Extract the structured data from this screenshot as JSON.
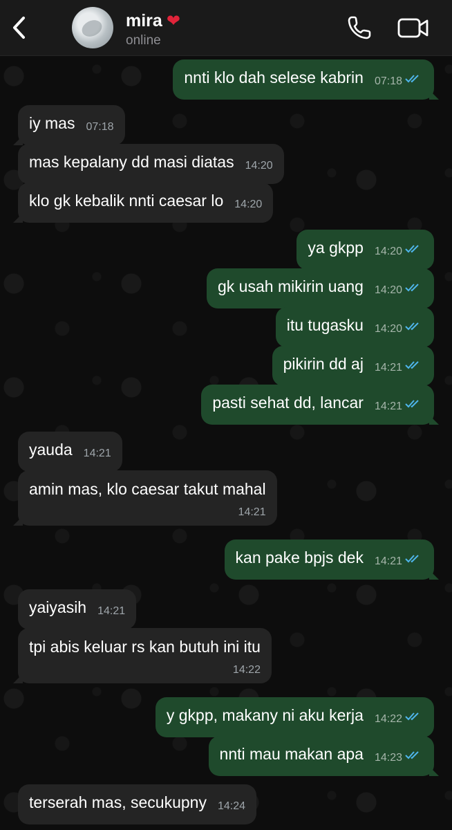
{
  "contact": {
    "name": "mira",
    "status": "online"
  },
  "icons": {
    "back": "chevron-left-icon",
    "call": "phone-icon",
    "video": "video-camera-icon",
    "read": "double-check-icon",
    "heart": "red-heart-emoji"
  },
  "colors": {
    "incoming_bubble": "#242424",
    "outgoing_bubble": "#1f4a2c",
    "read_ticks": "#4fb6ec",
    "heart": "#e0243a"
  },
  "messages": [
    {
      "dir": "out",
      "text": "nnti klo dah selese kabrin",
      "time": "07:18",
      "read": true
    },
    {
      "dir": "in",
      "text": "iy mas",
      "time": "07:18"
    },
    {
      "dir": "in",
      "text": "mas kepalany dd masi diatas",
      "time": "14:20"
    },
    {
      "dir": "in",
      "text": "klo gk kebalik nnti caesar lo",
      "time": "14:20"
    },
    {
      "dir": "out",
      "text": "ya gkpp",
      "time": "14:20",
      "read": true
    },
    {
      "dir": "out",
      "text": "gk usah mikirin uang",
      "time": "14:20",
      "read": true
    },
    {
      "dir": "out",
      "text": "itu tugasku",
      "time": "14:20",
      "read": true
    },
    {
      "dir": "out",
      "text": "pikirin dd aj",
      "time": "14:21",
      "read": true
    },
    {
      "dir": "out",
      "text": "pasti sehat dd, lancar",
      "time": "14:21",
      "read": true
    },
    {
      "dir": "in",
      "text": "yauda",
      "time": "14:21"
    },
    {
      "dir": "in",
      "text": "amin mas, klo caesar takut mahal",
      "time": "14:21"
    },
    {
      "dir": "out",
      "text": "kan pake bpjs dek",
      "time": "14:21",
      "read": true
    },
    {
      "dir": "in",
      "text": "yaiyasih",
      "time": "14:21"
    },
    {
      "dir": "in",
      "text": "tpi abis keluar rs kan butuh ini itu",
      "time": "14:22"
    },
    {
      "dir": "out",
      "text": "y gkpp, makany ni aku kerja",
      "time": "14:22",
      "read": true
    },
    {
      "dir": "out",
      "text": "nnti mau makan apa",
      "time": "14:23",
      "read": true
    },
    {
      "dir": "in",
      "text": "terserah mas, secukupny",
      "time": "14:24"
    }
  ]
}
